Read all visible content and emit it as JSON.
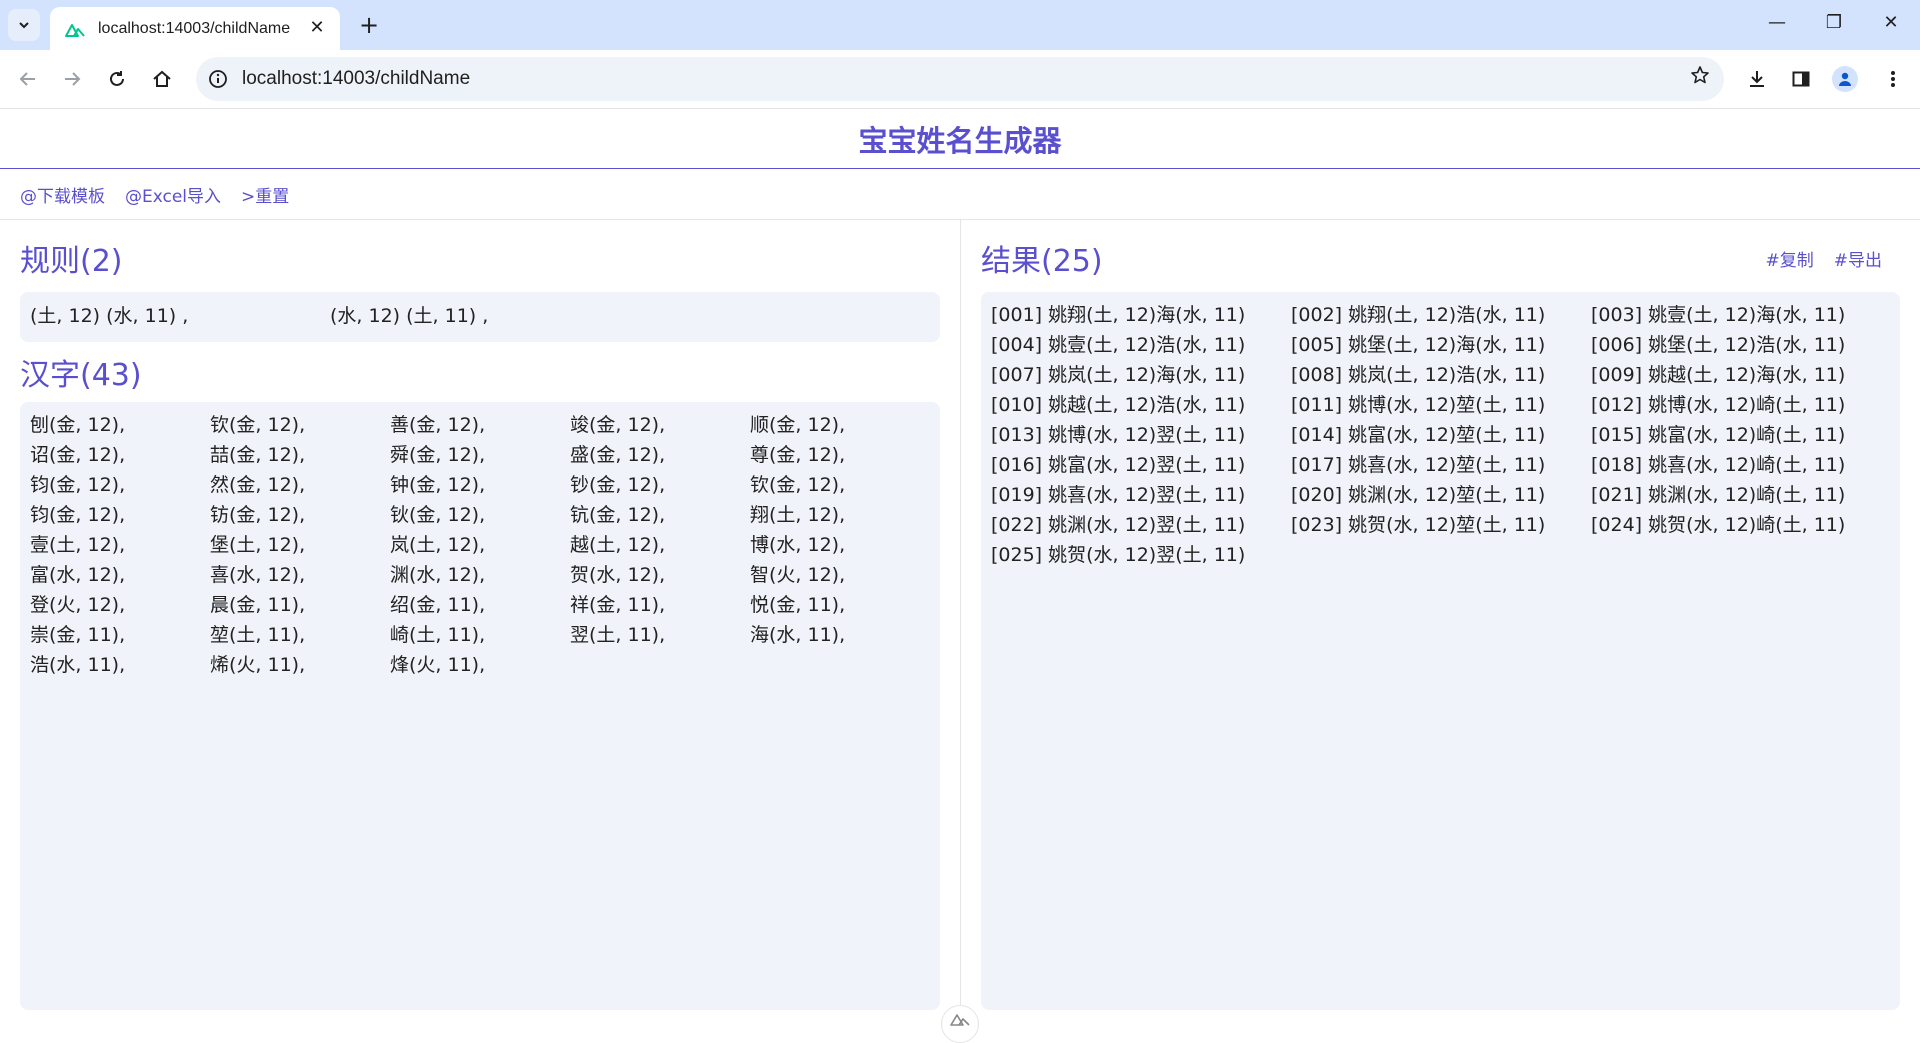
{
  "browser": {
    "tab_title": "localhost:14003/childName",
    "url": "localhost:14003/childName",
    "new_tab_symbol": "+",
    "close_symbol": "✕",
    "minimize_symbol": "—",
    "restore_symbol": "❐",
    "window_close_symbol": "✕",
    "accent_color": "#d3e3fd"
  },
  "page": {
    "title": "宝宝姓名生成器",
    "accent_color": "#5a4fcf",
    "actions": [
      "@下载模板",
      "@Excel导入",
      ">重置"
    ]
  },
  "rules": {
    "title": "规则(2)",
    "items": [
      "(土, 12) (水, 11) ,",
      "(水, 12) (土, 11) ,"
    ]
  },
  "hanzi": {
    "title": "汉字(43)",
    "items": [
      "刨(金, 12),",
      "钦(金, 12),",
      "善(金, 12),",
      "竣(金, 12),",
      "顺(金, 12),",
      "诏(金, 12),",
      "喆(金, 12),",
      "舜(金, 12),",
      "盛(金, 12),",
      "尊(金, 12),",
      "钧(金, 12),",
      "然(金, 12),",
      "钟(金, 12),",
      "钞(金, 12),",
      "钦(金, 12),",
      "钧(金, 12),",
      "钫(金, 12),",
      "钬(金, 12),",
      "钪(金, 12),",
      "翔(土, 12),",
      "壹(土, 12),",
      "堡(土, 12),",
      "岚(土, 12),",
      "越(土, 12),",
      "博(水, 12),",
      "富(水, 12),",
      "喜(水, 12),",
      "渊(水, 12),",
      "贺(水, 12),",
      "智(火, 12),",
      "登(火, 12),",
      "晨(金, 11),",
      "绍(金, 11),",
      "祥(金, 11),",
      "悦(金, 11),",
      "崇(金, 11),",
      "堃(土, 11),",
      "崎(土, 11),",
      "翌(土, 11),",
      "海(水, 11),",
      "浩(水, 11),",
      "烯(火, 11),",
      "烽(火, 11),"
    ]
  },
  "results": {
    "title": "结果(25)",
    "actions": [
      "#复制",
      "#导出"
    ],
    "items": [
      "[001] 姚翔(土, 12)海(水, 11)",
      "[002] 姚翔(土, 12)浩(水, 11)",
      "[003] 姚壹(土, 12)海(水, 11)",
      "[004] 姚壹(土, 12)浩(水, 11)",
      "[005] 姚堡(土, 12)海(水, 11)",
      "[006] 姚堡(土, 12)浩(水, 11)",
      "[007] 姚岚(土, 12)海(水, 11)",
      "[008] 姚岚(土, 12)浩(水, 11)",
      "[009] 姚越(土, 12)海(水, 11)",
      "[010] 姚越(土, 12)浩(水, 11)",
      "[011] 姚博(水, 12)堃(土, 11)",
      "[012] 姚博(水, 12)崎(土, 11)",
      "[013] 姚博(水, 12)翌(土, 11)",
      "[014] 姚富(水, 12)堃(土, 11)",
      "[015] 姚富(水, 12)崎(土, 11)",
      "[016] 姚富(水, 12)翌(土, 11)",
      "[017] 姚喜(水, 12)堃(土, 11)",
      "[018] 姚喜(水, 12)崎(土, 11)",
      "[019] 姚喜(水, 12)翌(土, 11)",
      "[020] 姚渊(水, 12)堃(土, 11)",
      "[021] 姚渊(水, 12)崎(土, 11)",
      "[022] 姚渊(水, 12)翌(土, 11)",
      "[023] 姚贺(水, 12)堃(土, 11)",
      "[024] 姚贺(水, 12)崎(土, 11)",
      "[025] 姚贺(水, 12)翌(土, 11)"
    ]
  },
  "icons": {
    "tab_menu": "chevron-down-icon",
    "back": "arrow-left-icon",
    "forward": "arrow-right-icon",
    "reload": "reload-icon",
    "home": "home-icon",
    "site_info": "info-icon",
    "bookmark": "star-icon",
    "download": "download-icon",
    "side_panel": "side-panel-icon",
    "profile": "profile-icon",
    "menu": "kebab-menu-icon",
    "devtools": "nuxt-devtools-icon"
  }
}
